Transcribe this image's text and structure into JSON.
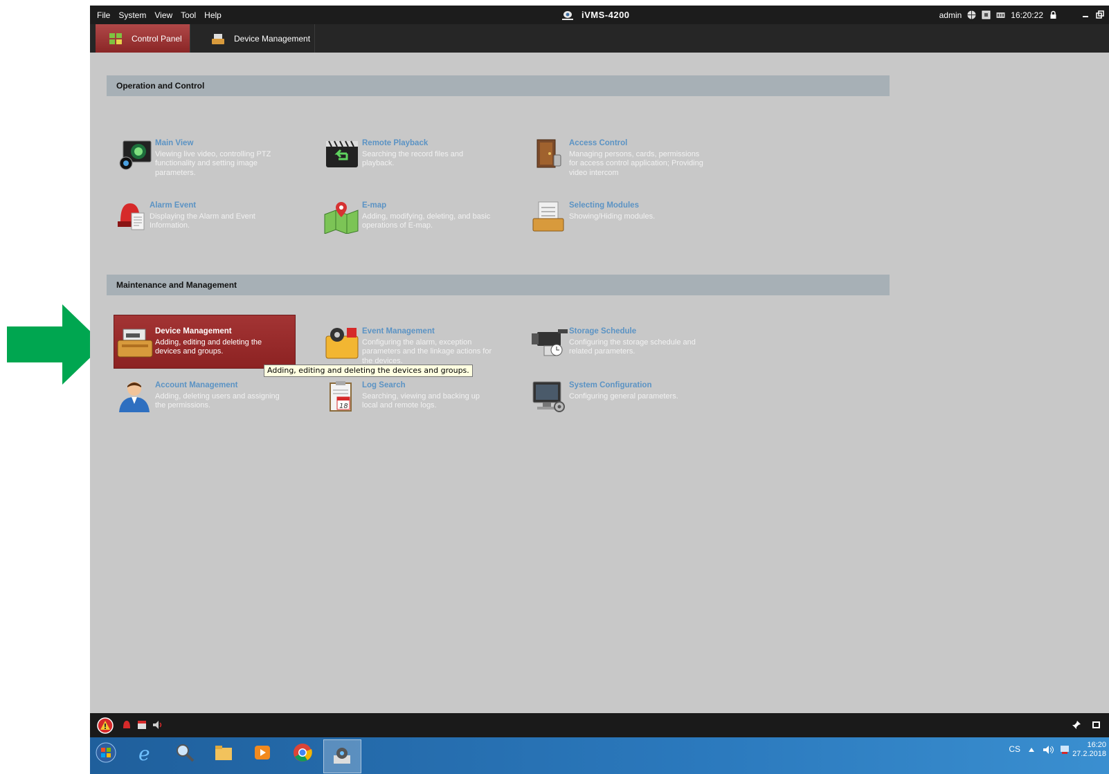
{
  "menu": [
    "File",
    "System",
    "View",
    "Tool",
    "Help"
  ],
  "app_title": "iVMS-4200",
  "status": {
    "user": "admin",
    "time": "16:20:22"
  },
  "tabs": [
    {
      "label": "Control Panel"
    },
    {
      "label": "Device Management"
    }
  ],
  "sections": {
    "operation": "Operation and Control",
    "maintenance": "Maintenance and Management"
  },
  "items": {
    "main_view": {
      "title": "Main View",
      "desc": "Viewing live video, controlling PTZ functionality and setting image parameters."
    },
    "remote_playback": {
      "title": "Remote Playback",
      "desc": "Searching the record files and playback."
    },
    "access_control": {
      "title": "Access Control",
      "desc": "Managing persons, cards, permissions for access control application; Providing video intercom"
    },
    "alarm_event": {
      "title": "Alarm Event",
      "desc": "Displaying the Alarm and Event Information."
    },
    "emap": {
      "title": "E-map",
      "desc": "Adding, modifying, deleting, and basic operations of E-map."
    },
    "selecting_modules": {
      "title": "Selecting Modules",
      "desc": "Showing/Hiding modules."
    },
    "device_management": {
      "title": "Device Management",
      "desc": "Adding, editing and deleting the devices and groups."
    },
    "event_management": {
      "title": "Event Management",
      "desc": "Configuring the alarm, exception parameters and the linkage actions for the devices."
    },
    "storage_schedule": {
      "title": "Storage Schedule",
      "desc": "Configuring the storage schedule and related parameters."
    },
    "account_management": {
      "title": "Account Management",
      "desc": "Adding, deleting users and assigning the permissions."
    },
    "log_search": {
      "title": "Log Search",
      "desc": "Searching, viewing and backing up local and remote logs."
    },
    "system_configuration": {
      "title": "System Configuration",
      "desc": "Configuring general parameters."
    }
  },
  "tooltip": "Adding, editing and deleting the devices and groups.",
  "taskbar": {
    "lang": "CS",
    "time": "16:20",
    "date": "27.2.2018"
  },
  "colors": {
    "accent_red": "#9a2a2a",
    "arrow_green": "#00a650",
    "title_blue": "#5b93c4"
  }
}
